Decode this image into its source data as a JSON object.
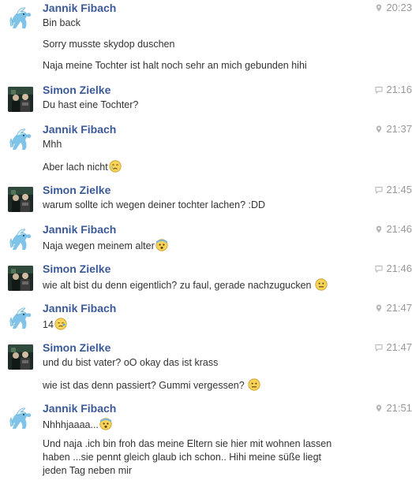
{
  "messages": [
    {
      "sender": "Jannik Fibach",
      "time": "20:23",
      "meta_icon": "location-pin-icon",
      "lines": [
        "Bin back",
        "Sorry musste skydop duschen",
        "Naja meine Tochter ist halt noch sehr an mich gebunden hihi"
      ]
    },
    {
      "sender": "Simon Zielke",
      "time": "21:16",
      "meta_icon": "chat-bubble-icon",
      "lines": [
        "Du hast eine Tochter?"
      ]
    },
    {
      "sender": "Jannik Fibach",
      "time": "21:37",
      "meta_icon": "location-pin-icon",
      "lines": [
        "Mhh",
        "Aber lach nicht"
      ]
    },
    {
      "sender": "Simon Zielke",
      "time": "21:45",
      "meta_icon": "chat-bubble-icon",
      "lines": [
        "warum sollte ich wegen deiner tochter lachen? :DD"
      ]
    },
    {
      "sender": "Jannik Fibach",
      "time": "21:46",
      "meta_icon": "location-pin-icon",
      "lines": [
        "Naja wegen meinem alter"
      ]
    },
    {
      "sender": "Simon Zielke",
      "time": "21:46",
      "meta_icon": "chat-bubble-icon",
      "lines": [
        "wie alt bist du denn eigentlich? zu faul, gerade nachzugucken"
      ]
    },
    {
      "sender": "Jannik Fibach",
      "time": "21:47",
      "meta_icon": "location-pin-icon",
      "lines": [
        "14"
      ]
    },
    {
      "sender": "Simon Zielke",
      "time": "21:47",
      "meta_icon": "chat-bubble-icon",
      "lines": [
        "und du bist vater? oO okay das ist krass",
        "wie ist das denn passiert? Gummi vergessen?"
      ]
    },
    {
      "sender": "Jannik Fibach",
      "time": "21:51",
      "meta_icon": "location-pin-icon",
      "lines": [
        "Nhhhjaaaa...",
        "Und naja .ich bin froh das meine Eltern sie hier mit wohnen lassen haben ...sie pennt gleich glaub ich schon.. Hihi meine süße liegt jeden Tag neben mir"
      ]
    }
  ],
  "emojis": {
    "crying": "crying-emoji",
    "shocked": "shocked-emoji",
    "neutral": "neutral-face-emoji",
    "embarrassed": "embarrassed-emoji"
  }
}
